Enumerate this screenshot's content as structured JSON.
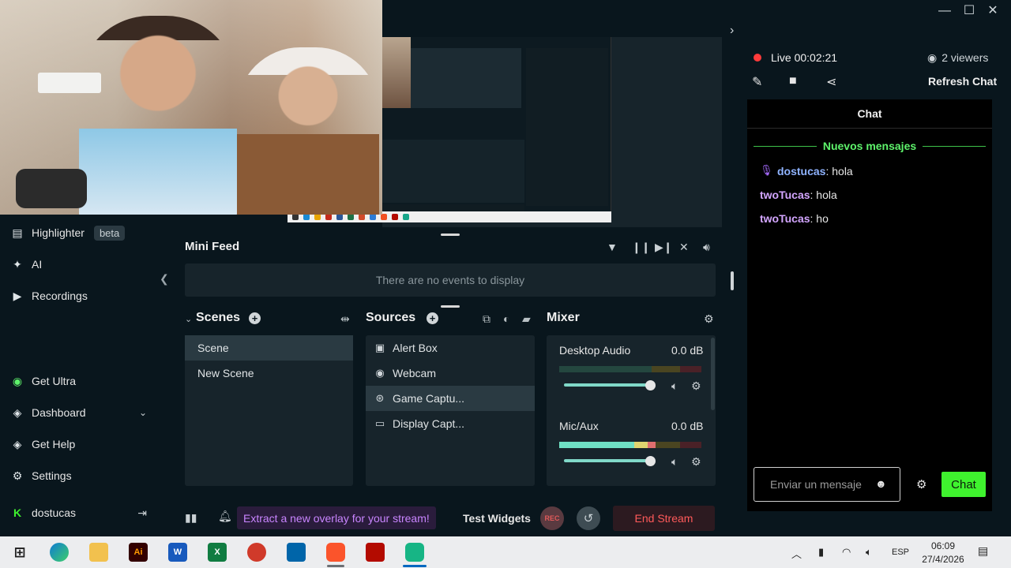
{
  "window": {
    "minimize": "—",
    "maximize": "☐",
    "close": "✕"
  },
  "sidebar": {
    "items": [
      {
        "label": "Highlighter",
        "badge": "beta",
        "icon": "highlighter-icon"
      },
      {
        "label": "AI",
        "icon": "sparkle-icon"
      },
      {
        "label": "Recordings",
        "icon": "play-circle-icon"
      },
      {
        "label": "Get Ultra",
        "icon": "ultra-icon"
      },
      {
        "label": "Dashboard",
        "icon": "dashboard-icon"
      },
      {
        "label": "Get Help",
        "icon": "help-icon"
      },
      {
        "label": "Settings",
        "icon": "gear-icon"
      }
    ],
    "user": "dostucas"
  },
  "mini_feed": {
    "title": "Mini Feed",
    "empty_text": "There are no events to display"
  },
  "scenes": {
    "title": "Scenes",
    "items": [
      "Scene",
      "New Scene"
    ],
    "selected": "Scene"
  },
  "sources": {
    "title": "Sources",
    "items": [
      {
        "label": "Alert Box",
        "icon": "alert-box-icon"
      },
      {
        "label": "Webcam",
        "icon": "webcam-icon"
      },
      {
        "label": "Game Captu...",
        "icon": "gamepad-icon"
      },
      {
        "label": "Display Capt...",
        "icon": "monitor-icon"
      }
    ],
    "selected": "Game Captu..."
  },
  "mixer": {
    "title": "Mixer",
    "channels": [
      {
        "name": "Desktop Audio",
        "db": "0.0 dB",
        "level": 0.0,
        "volume": 1.0
      },
      {
        "name": "Mic/Aux",
        "db": "0.0 dB",
        "level": 0.68,
        "volume": 1.0
      }
    ]
  },
  "bottom": {
    "extract": "Extract a new overlay for your stream!",
    "test_widgets": "Test Widgets",
    "rec": "REC",
    "end_stream": "End Stream"
  },
  "stream": {
    "status": "Live 00:02:21",
    "viewers": "2 viewers",
    "refresh_chat": "Refresh Chat"
  },
  "chat": {
    "title": "Chat",
    "new_messages": "Nuevos mensajes",
    "messages": [
      {
        "user": "dostucas",
        "text": ": hola"
      },
      {
        "user": "twoTucas",
        "text": ": hola"
      },
      {
        "user": "twoTucas",
        "text": ": ho"
      }
    ],
    "input_placeholder": "Enviar un mensaje",
    "send": "Chat"
  },
  "taskbar": {
    "apps": [
      "Ai",
      "W",
      "X"
    ],
    "lang": "ESP",
    "time": "06:09",
    "date": "27/4/2026",
    "accent_colors": {
      "green": "#3ff22e",
      "live": "#ff3b3b",
      "purple": "#c985ff"
    }
  }
}
